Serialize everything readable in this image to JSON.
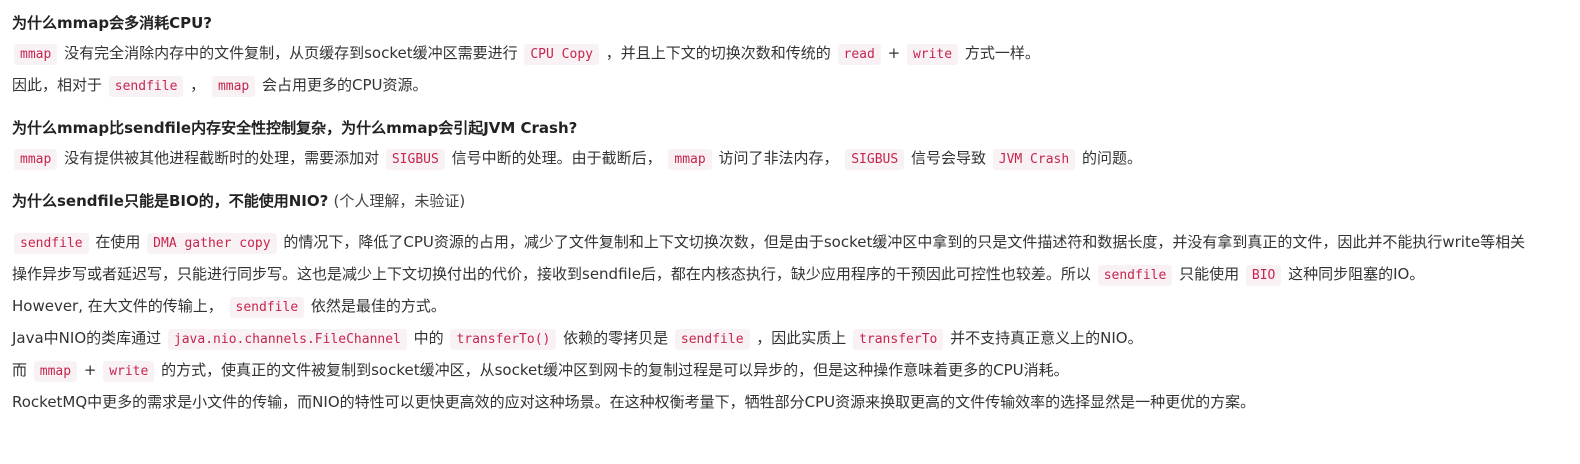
{
  "sections": [
    {
      "title": "为什么mmap会多消耗CPU?",
      "lines": [
        {
          "segments": [
            {
              "code": "mmap"
            },
            {
              "text": " 没有完全消除内存中的文件复制，从页缓存到socket缓冲区需要进行 "
            },
            {
              "code": "CPU Copy"
            },
            {
              "text": " ，并且上下文的切换次数和传统的 "
            },
            {
              "code": "read"
            },
            {
              "text": " + "
            },
            {
              "code": "write"
            },
            {
              "text": " 方式一样。"
            }
          ]
        },
        {
          "segments": [
            {
              "text": "因此，相对于 "
            },
            {
              "code": "sendfile"
            },
            {
              "text": " ， "
            },
            {
              "code": "mmap"
            },
            {
              "text": " 会占用更多的CPU资源。"
            }
          ]
        }
      ]
    },
    {
      "title": "为什么mmap比sendfile内存安全性控制复杂，为什么mmap会引起JVM Crash?",
      "lines": [
        {
          "segments": [
            {
              "code": "mmap"
            },
            {
              "text": " 没有提供被其他进程截断时的处理，需要添加对 "
            },
            {
              "code": "SIGBUS"
            },
            {
              "text": " 信号中断的处理。由于截断后， "
            },
            {
              "code": "mmap"
            },
            {
              "text": " 访问了非法内存， "
            },
            {
              "code": "SIGBUS"
            },
            {
              "text": " 信号会导致 "
            },
            {
              "code": "JVM Crash"
            },
            {
              "text": " 的问题。"
            }
          ]
        }
      ]
    },
    {
      "title": "为什么sendfile只能是BIO的，不能使用NIO?",
      "title_note": "(个人理解，未验证)",
      "lines": [
        {
          "segments": [
            {
              "code": "sendfile"
            },
            {
              "text": " 在使用 "
            },
            {
              "code": "DMA gather copy"
            },
            {
              "text": " 的情况下，降低了CPU资源的占用，减少了文件复制和上下文切换次数，但是由于socket缓冲区中拿到的只是文件描述符和数据长度，并没有拿到真正的文件，因此并不能执行write等相关操作异步写或者延迟写，只能进行同步写。这也是减少上下文切换付出的代价，接收到sendfile后，都在内核态执行，缺少应用程序的干预因此可控性也较差。所以 "
            },
            {
              "code": "sendfile"
            },
            {
              "text": " 只能使用 "
            },
            {
              "code": "BIO"
            },
            {
              "text": " 这种同步阻塞的IO。"
            }
          ]
        },
        {
          "segments": [
            {
              "text": "However, 在大文件的传输上， "
            },
            {
              "code": "sendfile"
            },
            {
              "text": " 依然是最佳的方式。"
            }
          ]
        },
        {
          "segments": [
            {
              "text": "Java中NIO的类库通过 "
            },
            {
              "code": "java.nio.channels.FileChannel"
            },
            {
              "text": " 中的 "
            },
            {
              "code": "transferTo()"
            },
            {
              "text": " 依赖的零拷贝是 "
            },
            {
              "code": "sendfile"
            },
            {
              "text": " ，因此实质上 "
            },
            {
              "code": "transferTo"
            },
            {
              "text": " 并不支持真正意义上的NIO。"
            }
          ]
        },
        {
          "segments": [
            {
              "text": "而 "
            },
            {
              "code": "mmap"
            },
            {
              "text": " + "
            },
            {
              "code": "write"
            },
            {
              "text": " 的方式，使真正的文件被复制到socket缓冲区，从socket缓冲区到网卡的复制过程是可以异步的，但是这种操作意味着更多的CPU消耗。"
            }
          ]
        },
        {
          "segments": [
            {
              "text": "RocketMQ中更多的需求是小文件的传输，而NIO的特性可以更快更高效的应对这种场景。在这种权衡考量下，牺牲部分CPU资源来换取更高的文件传输效率的选择显然是一种更优的方案。"
            }
          ]
        }
      ]
    }
  ],
  "colors": {
    "inline_code_text": "#c7254e",
    "inline_code_background": "#f9f2f4",
    "body_text": "#333333"
  }
}
